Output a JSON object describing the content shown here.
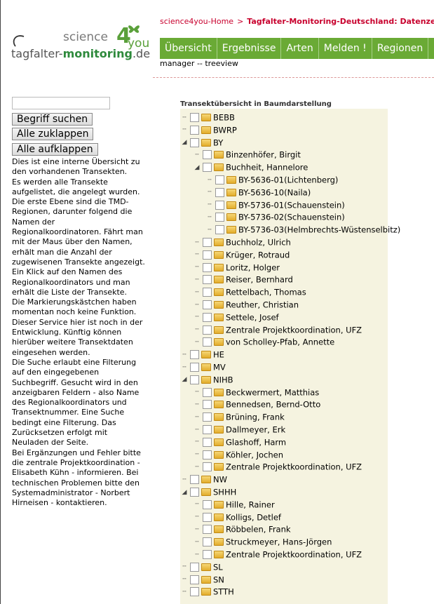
{
  "logo": {
    "science": "science",
    "four": "4",
    "you": "you",
    "tmd_prefix": "tagfalter-",
    "tmd_bold": "monitoring",
    "tmd_suffix": ".de"
  },
  "breadcrumb": {
    "home": "science4you-Home",
    "sep": ">",
    "current": "Tagfalter-Monitoring-Deutschland: Datenzentr"
  },
  "nav": [
    "Übersicht",
    "Ergebnisse",
    "Arten",
    "Melden !",
    "Regionen"
  ],
  "subline": "manager -- treeview",
  "search": {
    "value": ""
  },
  "buttons": {
    "search": "Begriff suchen",
    "collapse": "Alle zuklappen",
    "expand": "Alle aufklappen"
  },
  "info": [
    "Dies ist eine interne Übersicht zu den vorhandenen Transekten.",
    "Es werden alle Transekte aufgelistet, die angelegt wurden.",
    "Die erste Ebene sind die TMD-Regionen, darunter folgend die Namen der Regionalkoordinatoren. Fährt man mit der Maus über den Namen, erhält man die Anzahl der zugewisenen Transekte angezeigt.",
    "Ein Klick auf den Namen des Regionalkoordinators und man erhält die Liste der Transekte.",
    "Die Markierungskästchen haben momentan noch keine Funktion.",
    "Dieser Service hier ist noch in der Entwicklung. Künftig können hierüber weitere Transektdaten eingesehen werden.",
    "Die Suche erlaubt eine Filterung auf den eingegebenen Suchbegriff. Gesucht wird in den anzeigbaren Feldern - also Name des Regionalkoordinators und Transektnummer. Eine Suche bedingt eine Filterung. Das Zurücksetzen erfolgt mit Neuladen der Seite.",
    "Bei Ergänzungen und Fehler bitte die zentrale Projektkoordination - Elisabeth Kühn - informieren. Bei technischen Problemen bitte den Systemadministrator - Norbert Hirneisen - kontaktieren."
  ],
  "tree_title": "Transektübersicht in Baumdarstellung",
  "tree": [
    {
      "label": "BEBB",
      "level": 0,
      "expanded": false
    },
    {
      "label": "BWRP",
      "level": 0,
      "expanded": false
    },
    {
      "label": "BY",
      "level": 0,
      "expanded": true
    },
    {
      "label": "Binzenhöfer, Birgit",
      "level": 1,
      "expanded": false
    },
    {
      "label": "Buchheit, Hannelore",
      "level": 1,
      "expanded": true
    },
    {
      "label": "BY-5636-01(Lichtenberg)",
      "level": 2,
      "expanded": false
    },
    {
      "label": "BY-5636-10(Naila)",
      "level": 2,
      "expanded": false
    },
    {
      "label": "BY-5736-01(Schauenstein)",
      "level": 2,
      "expanded": false
    },
    {
      "label": "BY-5736-02(Schauenstein)",
      "level": 2,
      "expanded": false
    },
    {
      "label": "BY-5736-03(Helmbrechts-Wüstenselbitz)",
      "level": 2,
      "expanded": false
    },
    {
      "label": "Buchholz, Ulrich",
      "level": 1,
      "expanded": false
    },
    {
      "label": "Krüger, Rotraud",
      "level": 1,
      "expanded": false
    },
    {
      "label": "Loritz, Holger",
      "level": 1,
      "expanded": false
    },
    {
      "label": "Reiser, Bernhard",
      "level": 1,
      "expanded": false
    },
    {
      "label": "Rettelbach, Thomas",
      "level": 1,
      "expanded": false
    },
    {
      "label": "Reuther, Christian",
      "level": 1,
      "expanded": false
    },
    {
      "label": "Settele, Josef",
      "level": 1,
      "expanded": false
    },
    {
      "label": "Zentrale Projektkoordination, UFZ",
      "level": 1,
      "expanded": false
    },
    {
      "label": "von Scholley-Pfab, Annette",
      "level": 1,
      "expanded": false
    },
    {
      "label": "HE",
      "level": 0,
      "expanded": false
    },
    {
      "label": "MV",
      "level": 0,
      "expanded": false
    },
    {
      "label": "NIHB",
      "level": 0,
      "expanded": true
    },
    {
      "label": "Beckwermert, Matthias",
      "level": 1,
      "expanded": false
    },
    {
      "label": "Bennedsen, Bernd-Otto",
      "level": 1,
      "expanded": false
    },
    {
      "label": "Brüning, Frank",
      "level": 1,
      "expanded": false
    },
    {
      "label": "Dallmeyer, Erk",
      "level": 1,
      "expanded": false
    },
    {
      "label": "Glashoff, Harm",
      "level": 1,
      "expanded": false
    },
    {
      "label": "Köhler, Jochen",
      "level": 1,
      "expanded": false
    },
    {
      "label": "Zentrale Projektkoordination, UFZ",
      "level": 1,
      "expanded": false
    },
    {
      "label": "NW",
      "level": 0,
      "expanded": false
    },
    {
      "label": "SHHH",
      "level": 0,
      "expanded": true
    },
    {
      "label": "Hille, Rainer",
      "level": 1,
      "expanded": false
    },
    {
      "label": "Kolligs, Detlef",
      "level": 1,
      "expanded": false
    },
    {
      "label": "Röbbelen, Frank",
      "level": 1,
      "expanded": false
    },
    {
      "label": "Struckmeyer, Hans-Jörgen",
      "level": 1,
      "expanded": false
    },
    {
      "label": "Zentrale Projektkoordination, UFZ",
      "level": 1,
      "expanded": false
    },
    {
      "label": "SL",
      "level": 0,
      "expanded": false
    },
    {
      "label": "SN",
      "level": 0,
      "expanded": false
    },
    {
      "label": "STTH",
      "level": 0,
      "expanded": false
    }
  ]
}
